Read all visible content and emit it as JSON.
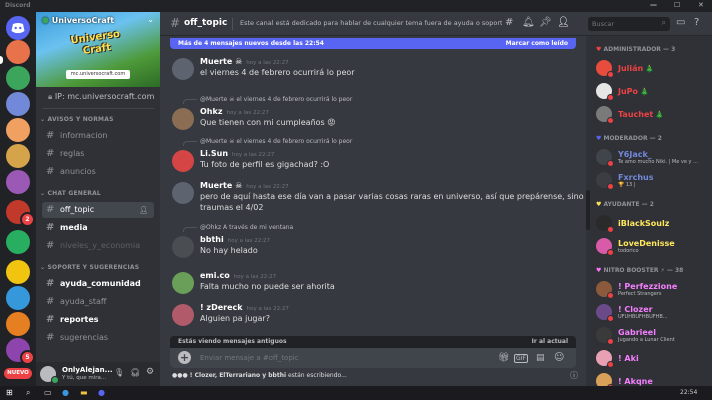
{
  "window": {
    "title": "Discord",
    "controls": [
      "—",
      "☐",
      "✕"
    ]
  },
  "rail": {
    "home_icon": "discord-logo-icon",
    "servers": [
      {
        "color": "#e8734a"
      },
      {
        "color": "#3ba55c"
      },
      {
        "color": "#7289da"
      },
      {
        "color": "#f0a060"
      },
      {
        "color": "#d4a34a"
      },
      {
        "color": "#9b59b6"
      },
      {
        "color": "#c0392b",
        "badge": "2"
      },
      {
        "color": "#27ae60"
      },
      {
        "color": "#f1c40f"
      },
      {
        "color": "#3498db"
      },
      {
        "color": "#e67e22"
      },
      {
        "color": "#8e44ad",
        "badge": "5"
      }
    ],
    "new_label": "NUEVO"
  },
  "sidebar": {
    "server_name": "UniversoCraft",
    "banner_logo": "Universo Craft",
    "banner_url": "mc.universocraft.com",
    "ip_label": "IP: mc.universocraft.com",
    "categories": [
      {
        "name": "AVISOS Y NORMAS",
        "channels": [
          {
            "name": "informacion",
            "style": "normal"
          },
          {
            "name": "reglas",
            "style": "normal"
          },
          {
            "name": "anuncios",
            "style": "normal"
          }
        ]
      },
      {
        "name": "CHAT GENERAL",
        "channels": [
          {
            "name": "off_topic",
            "style": "selected"
          },
          {
            "name": "media",
            "style": "bright"
          },
          {
            "name": "niveles_y_economia",
            "style": "muted"
          }
        ]
      },
      {
        "name": "SOPORTE Y SUGERENCIAS",
        "channels": [
          {
            "name": "ayuda_comunidad",
            "style": "bright"
          },
          {
            "name": "ayuda_staff",
            "style": "normal"
          },
          {
            "name": "reportes",
            "style": "bright"
          },
          {
            "name": "sugerencias",
            "style": "normal"
          }
        ]
      }
    ],
    "user": {
      "name": "OnlyAlejan...",
      "status": "Y tú, que mira..."
    }
  },
  "header": {
    "channel": "off_topic",
    "topic": "Este canal está dedicado para hablar de cualquier tema fuera de ayuda o soporte d...",
    "search_placeholder": "Buscar"
  },
  "new_messages_bar": {
    "text": "Más de 4 mensajes nuevos desde las 22:54",
    "action": "Marcar como leído"
  },
  "messages": [
    {
      "author": "Muerte ☠",
      "time": "hoy a las 22:27",
      "text": "el viernes 4 de febrero ocurrirá lo peor",
      "name_color": "#ffffff",
      "avatar": "#5d6470"
    },
    {
      "reply": "@Muerte ☠ el viernes 4 de febrero ocurrirá lo peor",
      "author": "Ohkz",
      "time": "hoy a las 22:27",
      "text": "Que tienen con mi cumpleaños 😡",
      "name_color": "#ffffff",
      "avatar": "#8a6d52"
    },
    {
      "reply": "@Muerte ☠ el viernes 4 de febrero ocurrirá lo peor",
      "author": "Li.Sun",
      "time": "hoy a las 22:27",
      "text": "Tu foto de perfil es gigachad? :O",
      "name_color": "#ffffff",
      "avatar": "#d64545"
    },
    {
      "author": "Muerte ☠",
      "time": "hoy a las 22:27",
      "text": "pero de aquí hasta ese día van a pasar varias cosas raras en universo, así que prepárense, sino quieren",
      "text2": "traumas el 4/02",
      "name_color": "#ffffff",
      "avatar": "#5d6470"
    },
    {
      "reply": "@Ohkz A través de mi ventana",
      "author": "bbthi",
      "time": "hoy a las 22:27",
      "text": "No hay helado",
      "name_color": "#ffffff",
      "avatar": "#4a4d52"
    },
    {
      "author": "emi.co",
      "time": "hoy a las 22:27",
      "text": "Falta mucho no puede ser ahorita",
      "name_color": "#ffffff",
      "avatar": "#6a9f5a"
    },
    {
      "author": "! zDereck",
      "time": "hoy a las 22:27",
      "text": "Alguien pa jugar?",
      "name_color": "#ffffff",
      "avatar": "#b05a6a"
    }
  ],
  "old_messages_bar": {
    "text": "Estás viendo mensajes antiguos",
    "action": "Ir al actual"
  },
  "composer": {
    "placeholder": "Enviar mensaje a #off_topic"
  },
  "typing": {
    "names": "! Clozer, ElTerrariano y bbthi",
    "suffix": "están escribiendo..."
  },
  "members": {
    "sections": [
      {
        "title": "ADMINISTRADOR — 3",
        "icon_color": "#ed4245",
        "items": [
          {
            "name": "Julián",
            "color": "#ed4245",
            "avatar": "#e74c3c",
            "emoji": "🎄"
          },
          {
            "name": "JuPo",
            "color": "#ed4245",
            "avatar": "#e6e6e6",
            "emoji": "🎄"
          },
          {
            "name": "Tauchet",
            "color": "#ed4245",
            "avatar": "#7a7a7a",
            "emoji": "🎄"
          }
        ]
      },
      {
        "title": "MODERADOR — 2",
        "icon_color": "#5865f2",
        "items": [
          {
            "name": "Y6Jack_",
            "color": "#7289da",
            "avatar": "#40444b",
            "activity": "Te amo mucho Niki. | Me ve y ..."
          },
          {
            "name": "Fxrchus",
            "color": "#7289da",
            "avatar": "#3a3d42",
            "activity": "🏆 13 |"
          }
        ]
      },
      {
        "title": "AYUDANTE — 2",
        "icon_color": "#fee75c",
        "items": [
          {
            "name": "iBlackSoulz",
            "color": "#fee75c",
            "avatar": "#2a2a2a"
          },
          {
            "name": "LoveDenisse",
            "color": "#fee75c",
            "avatar": "#d95aa8",
            "activity": "todorico"
          }
        ]
      },
      {
        "title": "NITRO BOOSTER ⚡ — 38",
        "icon_color": "#ff73fa",
        "items": [
          {
            "name": "! Perfezzione",
            "color": "#f47fff",
            "avatar": "#8b5a3c",
            "activity": "Perfect Strangers"
          },
          {
            "name": "! Clozer",
            "color": "#f47fff",
            "avatar": "#6b4a8a",
            "activity": "UFUHBUFHBUFHB..."
          },
          {
            "name": "Gabrieel",
            "color": "#f47fff",
            "avatar": "#3a3a3a",
            "activity": "Jugando a Lunar Client"
          },
          {
            "name": "! Aki",
            "color": "#f47fff",
            "avatar": "#e8a0b5"
          },
          {
            "name": "! Akqne",
            "color": "#f47fff",
            "avatar": "#d9a05a"
          }
        ]
      }
    ]
  },
  "taskbar": {
    "clock": "22:54"
  }
}
